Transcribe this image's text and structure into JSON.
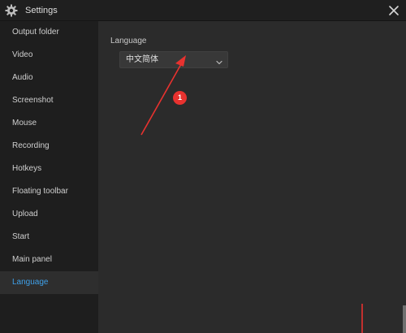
{
  "window": {
    "title": "Settings"
  },
  "sidebar": {
    "items": [
      {
        "label": "Output folder",
        "active": false
      },
      {
        "label": "Video",
        "active": false
      },
      {
        "label": "Audio",
        "active": false
      },
      {
        "label": "Screenshot",
        "active": false
      },
      {
        "label": "Mouse",
        "active": false
      },
      {
        "label": "Recording",
        "active": false
      },
      {
        "label": "Hotkeys",
        "active": false
      },
      {
        "label": "Floating toolbar",
        "active": false
      },
      {
        "label": "Upload",
        "active": false
      },
      {
        "label": "Start",
        "active": false
      },
      {
        "label": "Main panel",
        "active": false
      },
      {
        "label": "Language",
        "active": true
      }
    ]
  },
  "main": {
    "section_label": "Language",
    "language_select": {
      "value": "中文简体"
    }
  },
  "annotation": {
    "badge": "1"
  },
  "icons": {
    "title": "gear-icon",
    "close": "close-icon",
    "dropdown": "chevron-down-icon"
  },
  "colors": {
    "accent": "#3fa0e8",
    "annotation": "#e8322f",
    "sidebar_bg": "#1e1e1e",
    "content_bg": "#2b2b2b"
  }
}
